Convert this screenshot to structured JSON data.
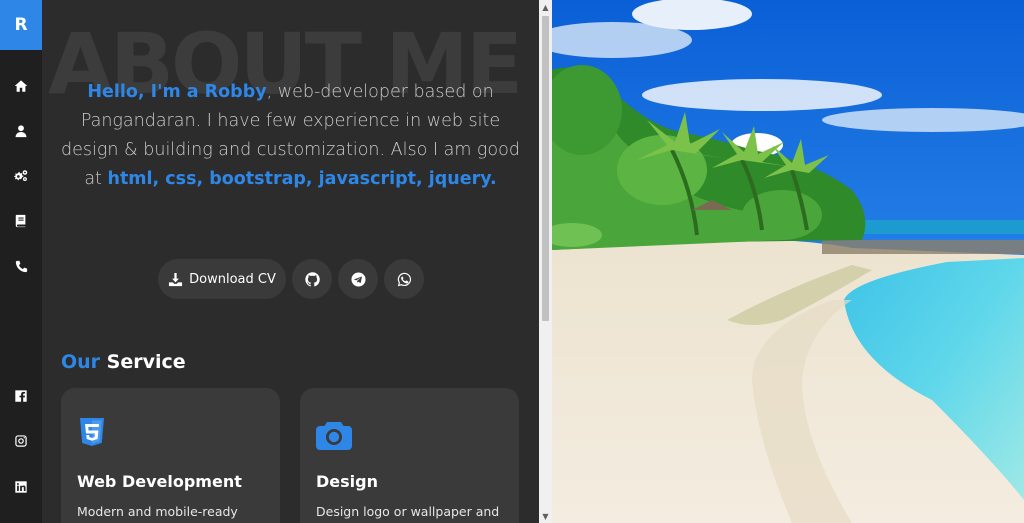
{
  "sidebar": {
    "logo": "R",
    "nav": [
      {
        "icon": "home-icon"
      },
      {
        "icon": "user-icon"
      },
      {
        "icon": "gears-icon"
      },
      {
        "icon": "book-icon"
      },
      {
        "icon": "phone-icon"
      }
    ],
    "social": [
      {
        "icon": "facebook-icon"
      },
      {
        "icon": "instagram-icon"
      },
      {
        "icon": "linkedin-icon"
      }
    ]
  },
  "about": {
    "bg_title": "ABOUT ME",
    "greeting": "Hello, I'm a Robby",
    "text_1": ", web-developer based on Pangandaran. I have few experience in web site design & building and customization. Also I am good at ",
    "skills": "html, css, bootstrap, javascript, jquery.",
    "download_label": "Download CV"
  },
  "service": {
    "title_accent": "Our",
    "title_rest": " Service",
    "cards": [
      {
        "icon": "html5-icon",
        "title": "Web Development",
        "desc": "Modern and mobile-ready"
      },
      {
        "icon": "camera-icon",
        "title": "Design",
        "desc": "Design logo or wallpaper and"
      }
    ]
  },
  "colors": {
    "accent": "#2e86e6",
    "sidebar": "#1f1f1f",
    "content_bg": "#2c2c2c",
    "card_bg": "#3a3a3a"
  }
}
